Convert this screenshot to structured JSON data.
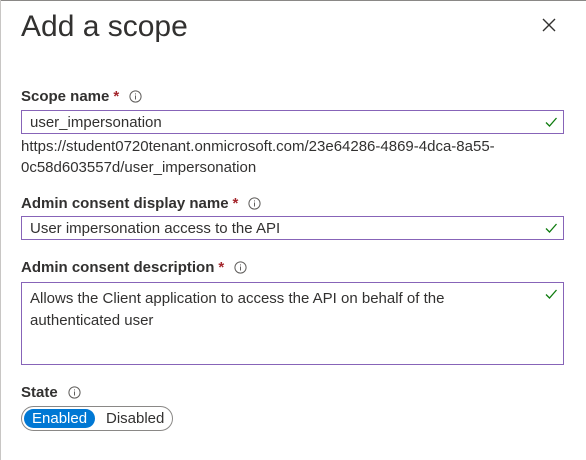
{
  "panel": {
    "title": "Add a scope"
  },
  "fields": {
    "scope_name": {
      "label": "Scope name",
      "required": "*",
      "value": "user_impersonation"
    },
    "scope_uri": "https://student0720tenant.onmicrosoft.com/23e64286-4869-4dca-8a55-0c58d603557d/user_impersonation",
    "admin_display_name": {
      "label": "Admin consent display name",
      "required": "*",
      "value": "User impersonation access to the API"
    },
    "admin_description": {
      "label": "Admin consent description",
      "required": "*",
      "value": "Allows the Client application to access the API on behalf of the authenticated user"
    }
  },
  "state": {
    "label": "State",
    "options": [
      "Enabled",
      "Disabled"
    ],
    "selected": "Enabled"
  },
  "icons": {
    "close": "close-icon",
    "info": "info-icon",
    "valid": "checkmark-icon"
  },
  "colors": {
    "accent": "#0078d4",
    "field_border": "#8764b8",
    "required": "#a4262c",
    "valid": "#107c10"
  }
}
